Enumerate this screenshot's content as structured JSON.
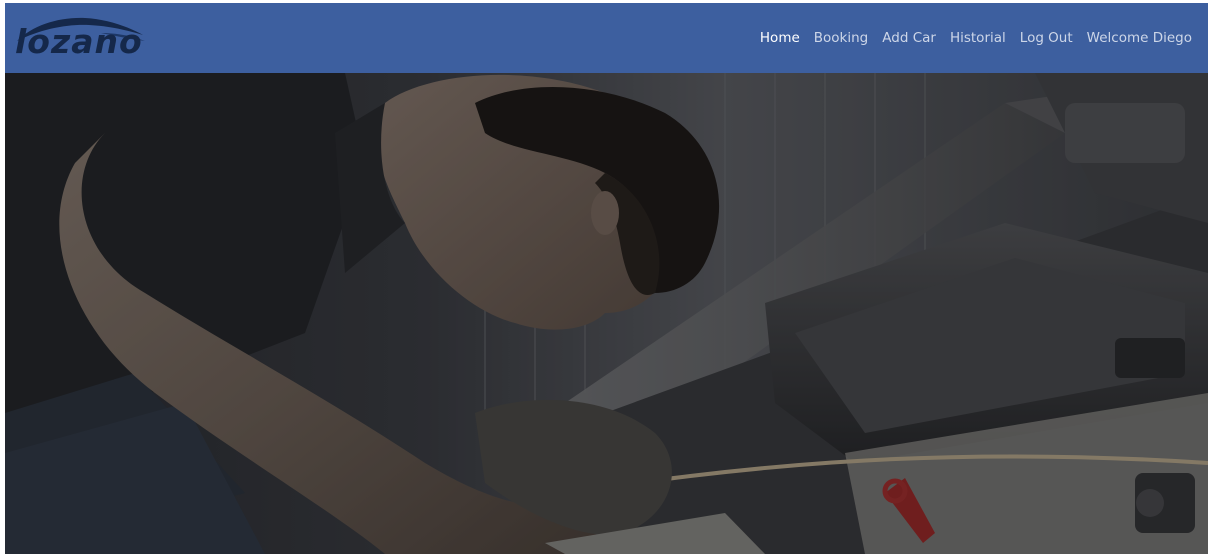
{
  "brand": {
    "name": "lozano",
    "logo_color": "#15284a",
    "navbar_color": "#3d5f9f"
  },
  "nav": {
    "items": [
      {
        "label": "Home",
        "active": true
      },
      {
        "label": "Booking",
        "active": false
      },
      {
        "label": "Add Car",
        "active": false
      },
      {
        "label": "Historial",
        "active": false
      },
      {
        "label": "Log Out",
        "active": false
      },
      {
        "label": "Welcome Diego",
        "active": false
      }
    ]
  },
  "hero": {
    "icon": "mechanic-working-on-car-engine-photo"
  }
}
